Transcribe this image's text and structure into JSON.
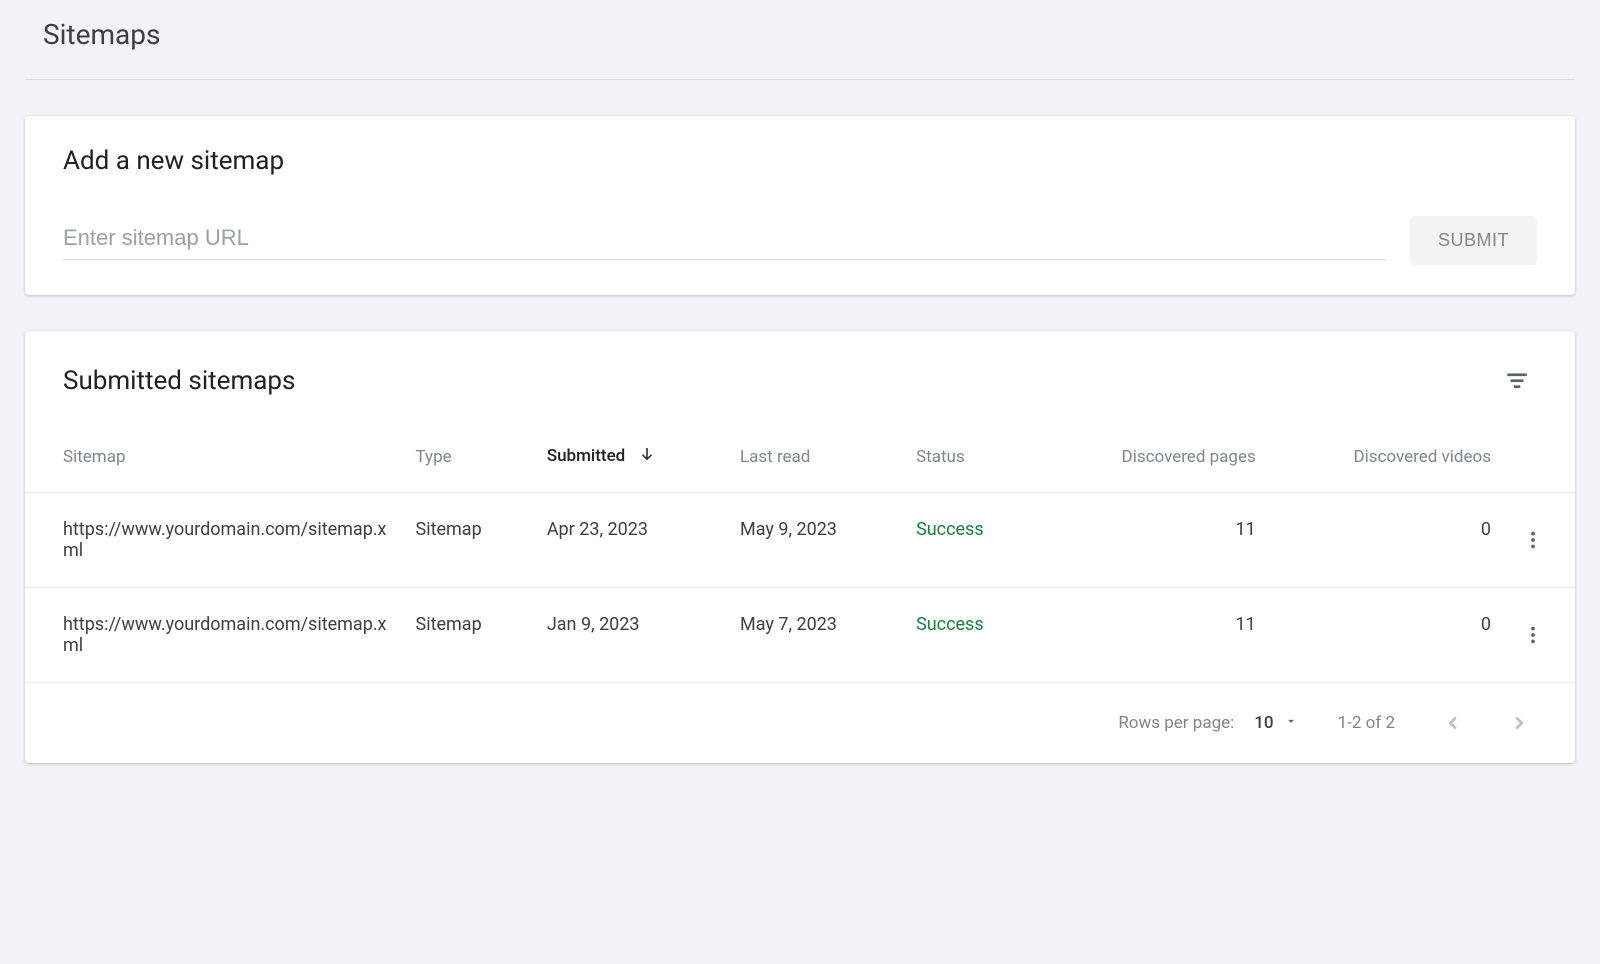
{
  "page": {
    "title": "Sitemaps"
  },
  "add_sitemap": {
    "title": "Add a new sitemap",
    "placeholder": "Enter sitemap URL",
    "value": "",
    "submit_label": "SUBMIT"
  },
  "submitted": {
    "title": "Submitted sitemaps",
    "columns": {
      "sitemap": "Sitemap",
      "type": "Type",
      "submitted": "Submitted",
      "last_read": "Last read",
      "status": "Status",
      "discovered_pages": "Discovered pages",
      "discovered_videos": "Discovered videos"
    },
    "sort": {
      "column": "submitted",
      "direction": "desc"
    },
    "rows": [
      {
        "sitemap": "https://www.yourdomain.com/sitemap.xml",
        "type": "Sitemap",
        "submitted": "Apr 23, 2023",
        "last_read": "May 9, 2023",
        "status": "Success",
        "discovered_pages": "11",
        "discovered_videos": "0"
      },
      {
        "sitemap": "https://www.yourdomain.com/sitemap.xml",
        "type": "Sitemap",
        "submitted": "Jan 9, 2023",
        "last_read": "May 7, 2023",
        "status": "Success",
        "discovered_pages": "11",
        "discovered_videos": "0"
      }
    ],
    "footer": {
      "rows_per_page_label": "Rows per page:",
      "rows_per_page_value": "10",
      "range_label": "1-2 of 2"
    }
  }
}
